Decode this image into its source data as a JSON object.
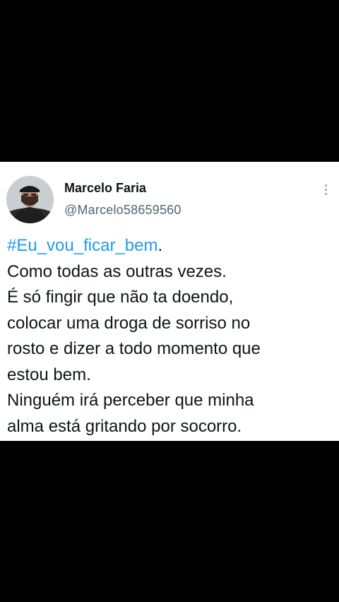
{
  "tweet": {
    "author": {
      "display_name": "Marcelo Faria",
      "handle": "@Marcelo58659560"
    },
    "more_icon": "vertical-ellipsis-icon",
    "hashtag": "#Eu_vou_ficar_bem",
    "hashtag_suffix": ".",
    "lines": [
      "Como todas as outras vezes.",
      "É só fingir que não ta doendo,",
      "colocar uma droga de sorriso no",
      "rosto e dizer a todo momento que",
      "estou bem.",
      "Ninguém irá perceber que minha",
      "alma está gritando por socorro."
    ]
  },
  "colors": {
    "background": "#000000",
    "card": "#ffffff",
    "text": "#0f1419",
    "secondary_text": "#536471",
    "hashtag": "#1d9bf0"
  }
}
